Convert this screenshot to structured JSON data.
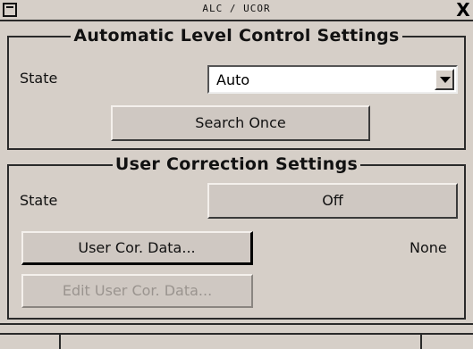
{
  "window": {
    "title": "ALC / UCOR",
    "close_glyph": "X"
  },
  "alc": {
    "heading": "Automatic Level Control Settings",
    "state_label": "State",
    "state_value": "Auto",
    "search_button": "Search Once"
  },
  "ucor": {
    "heading": "User Correction Settings",
    "state_label": "State",
    "state_button": "Off",
    "user_cor_button": "User Cor. Data...",
    "user_cor_value": "None",
    "edit_button": "Edit User Cor. Data..."
  },
  "icons": {
    "system_menu": "system-menu-icon",
    "close": "close-icon",
    "dropdown_arrow": "chevron-down-icon"
  },
  "colors": {
    "background": "#d6cfc8",
    "button": "#cfc8c2",
    "disabled_text": "#9a948f"
  }
}
